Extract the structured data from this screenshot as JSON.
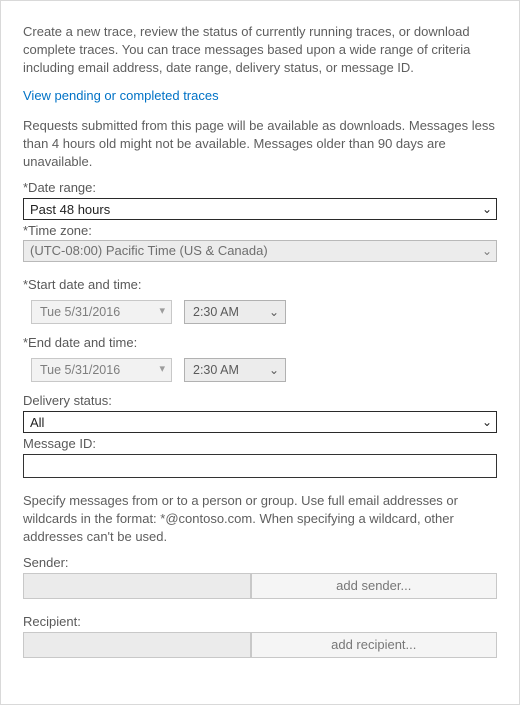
{
  "intro": "Create a new trace, review the status of currently running traces, or download complete traces. You can trace messages based upon a wide range of criteria including email address, date range, delivery status, or message ID.",
  "link": "View pending or completed traces",
  "availability": "Requests submitted from this page will be available as downloads. Messages less than 4 hours old might not be available. Messages older than 90 days are unavailable.",
  "labels": {
    "date_range": "*Date range:",
    "time_zone": "*Time zone:",
    "start_dt": "*Start date and time:",
    "end_dt": "*End date and time:",
    "delivery_status": "Delivery status:",
    "message_id": "Message ID:",
    "sender": "Sender:",
    "recipient": "Recipient:"
  },
  "values": {
    "date_range": "Past 48 hours",
    "time_zone": "(UTC-08:00) Pacific Time (US & Canada)",
    "start_date": "Tue 5/31/2016",
    "start_time": "2:30 AM",
    "end_date": "Tue 5/31/2016",
    "end_time": "2:30 AM",
    "delivery_status": "All",
    "message_id": ""
  },
  "specify_text": "Specify messages from or to a person or group. Use full email addresses or wildcards in the format: *@contoso.com. When specifying a wildcard, other addresses can't be used.",
  "buttons": {
    "add_sender": "add sender...",
    "add_recipient": "add recipient..."
  }
}
